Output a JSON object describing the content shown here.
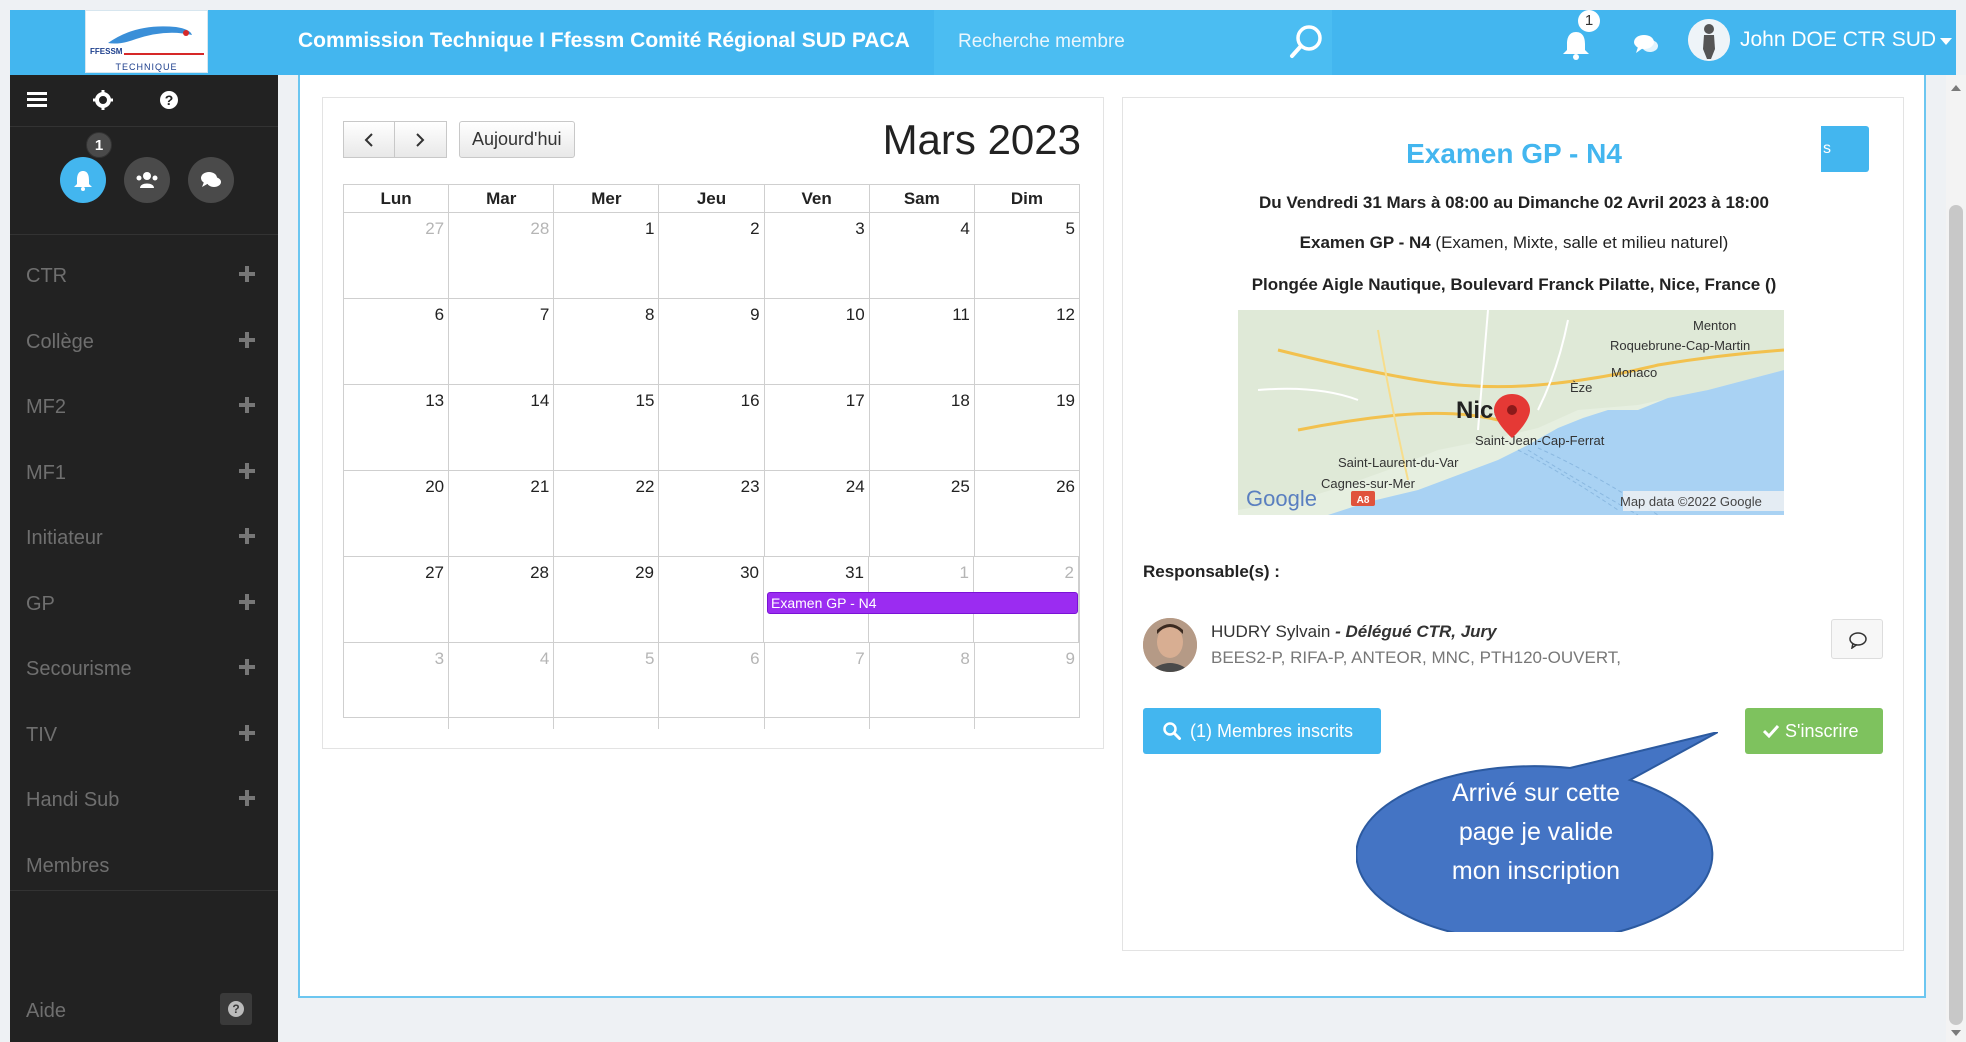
{
  "header": {
    "logo_top": "FFESSM",
    "logo_bottom": "TECHNIQUE",
    "title": "Commission Technique I Ffessm Comité Régional SUD PACA",
    "search_placeholder": "Recherche membre",
    "notification_count": "1",
    "user_name": "John DOE CTR SUD"
  },
  "sidebar": {
    "notification_badge": "1",
    "items": [
      {
        "label": "CTR",
        "has_plus": true
      },
      {
        "label": "Collège",
        "has_plus": true
      },
      {
        "label": "MF2",
        "has_plus": true
      },
      {
        "label": "MF1",
        "has_plus": true
      },
      {
        "label": "Initiateur",
        "has_plus": true
      },
      {
        "label": "GP",
        "has_plus": true
      },
      {
        "label": "Secourisme",
        "has_plus": true
      },
      {
        "label": "TIV",
        "has_plus": true
      },
      {
        "label": "Handi Sub",
        "has_plus": true
      },
      {
        "label": "Membres",
        "has_plus": false
      }
    ],
    "help_label": "Aide"
  },
  "calendar": {
    "today_label": "Aujourd'hui",
    "month_title": "Mars 2023",
    "weekdays": [
      "Lun",
      "Mar",
      "Mer",
      "Jeu",
      "Ven",
      "Sam",
      "Dim"
    ],
    "weeks": [
      [
        {
          "d": "27",
          "o": true
        },
        {
          "d": "28",
          "o": true
        },
        {
          "d": "1"
        },
        {
          "d": "2"
        },
        {
          "d": "3"
        },
        {
          "d": "4"
        },
        {
          "d": "5"
        }
      ],
      [
        {
          "d": "6"
        },
        {
          "d": "7"
        },
        {
          "d": "8"
        },
        {
          "d": "9"
        },
        {
          "d": "10"
        },
        {
          "d": "11"
        },
        {
          "d": "12"
        }
      ],
      [
        {
          "d": "13"
        },
        {
          "d": "14"
        },
        {
          "d": "15"
        },
        {
          "d": "16"
        },
        {
          "d": "17"
        },
        {
          "d": "18"
        },
        {
          "d": "19"
        }
      ],
      [
        {
          "d": "20"
        },
        {
          "d": "21"
        },
        {
          "d": "22"
        },
        {
          "d": "23"
        },
        {
          "d": "24"
        },
        {
          "d": "25"
        },
        {
          "d": "26"
        }
      ],
      [
        {
          "d": "27"
        },
        {
          "d": "28"
        },
        {
          "d": "29"
        },
        {
          "d": "30"
        },
        {
          "d": "31"
        },
        {
          "d": "1",
          "o": true
        },
        {
          "d": "2",
          "o": true
        }
      ],
      [
        {
          "d": "3",
          "o": true
        },
        {
          "d": "4",
          "o": true
        },
        {
          "d": "5",
          "o": true
        },
        {
          "d": "6",
          "o": true
        },
        {
          "d": "7",
          "o": true
        },
        {
          "d": "8",
          "o": true
        },
        {
          "d": "9",
          "o": true
        }
      ]
    ],
    "event": {
      "label": "Examen GP - N4",
      "color": "#9b2cf1"
    }
  },
  "detail": {
    "title": "Examen GP - N4",
    "actions_label": "s",
    "dates": "Du Vendredi 31 Mars à 08:00 au Dimanche 02 Avril 2023 à 18:00",
    "type_bold": "Examen GP - N4",
    "type_rest": " (Examen, Mixte, salle et milieu naturel)",
    "location": "Plongée Aigle Nautique, Boulevard Franck Pilatte, Nice, France ()",
    "map": {
      "labels": [
        "Menton",
        "Roquebrune-Cap-Martin",
        "Monaco",
        "Èze",
        "Nice",
        "Saint-Jean-Cap-Ferrat",
        "Saint-Laurent-du-Var",
        "Cagnes-sur-Mer"
      ],
      "road_badge": "A8",
      "brand": "Google",
      "attribution": "Map data ©2022 Google"
    },
    "responsables_label": "Responsable(s) :",
    "responsable": {
      "name": "HUDRY Sylvain",
      "role": " - Délégué CTR, Jury",
      "qualifications": "BEES2-P, RIFA-P, ANTEOR, MNC, PTH120-OUVERT,"
    },
    "members_button": "(1) Membres inscrits",
    "register_button": "S'inscrire"
  },
  "callout": {
    "lines": [
      "Arrivé sur cette",
      "page je valide",
      "mon inscription"
    ],
    "color": "#4474c4"
  },
  "colors": {
    "accent": "#43b6ef",
    "success": "#7ec25e",
    "sidebar": "#222222"
  }
}
